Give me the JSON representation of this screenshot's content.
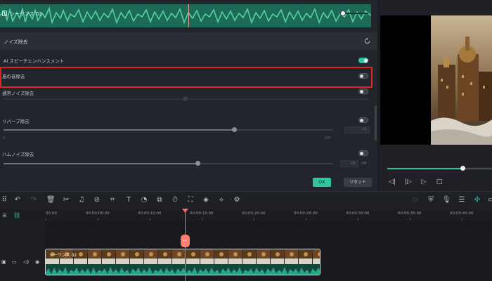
{
  "sequence": {
    "name": "シーケンス 02"
  },
  "noise_panel": {
    "title": "ノイズ除去",
    "rows": {
      "ai_speech": {
        "label": "AI スピーチエンハンスメント",
        "enabled": true
      },
      "wind": {
        "label": "風の音除去",
        "enabled": false
      },
      "normal": {
        "label": "通常ノイズ除去",
        "enabled": false
      },
      "reverb": {
        "label": "リバーブ除去",
        "enabled": false,
        "value": "70",
        "level": 0.7,
        "min_label": "0",
        "max_label": "100"
      },
      "hum": {
        "label": "ハムノイズ除去",
        "enabled": false,
        "value": "-25",
        "unit": "dB",
        "level": 0.59
      }
    },
    "ok_label": "OK",
    "reset_label": "リセット"
  },
  "preview": {
    "progress": 0.72
  },
  "timeline": {
    "ruler": [
      "00:00",
      "00:00:05:00",
      "00:00:10:00",
      "00:00:15:00",
      "00:00:20:00",
      "00:00:25:00",
      "00:00:30:00",
      "00:00:35:00",
      "00:00:40:00"
    ],
    "clip_title": "シーケンス 02",
    "playhead_marker_glyph": "✂"
  },
  "colors": {
    "accent": "#2ec6a0",
    "highlight": "#e02424",
    "playhead": "#ff6b61",
    "waveform": "#1d6b56"
  }
}
